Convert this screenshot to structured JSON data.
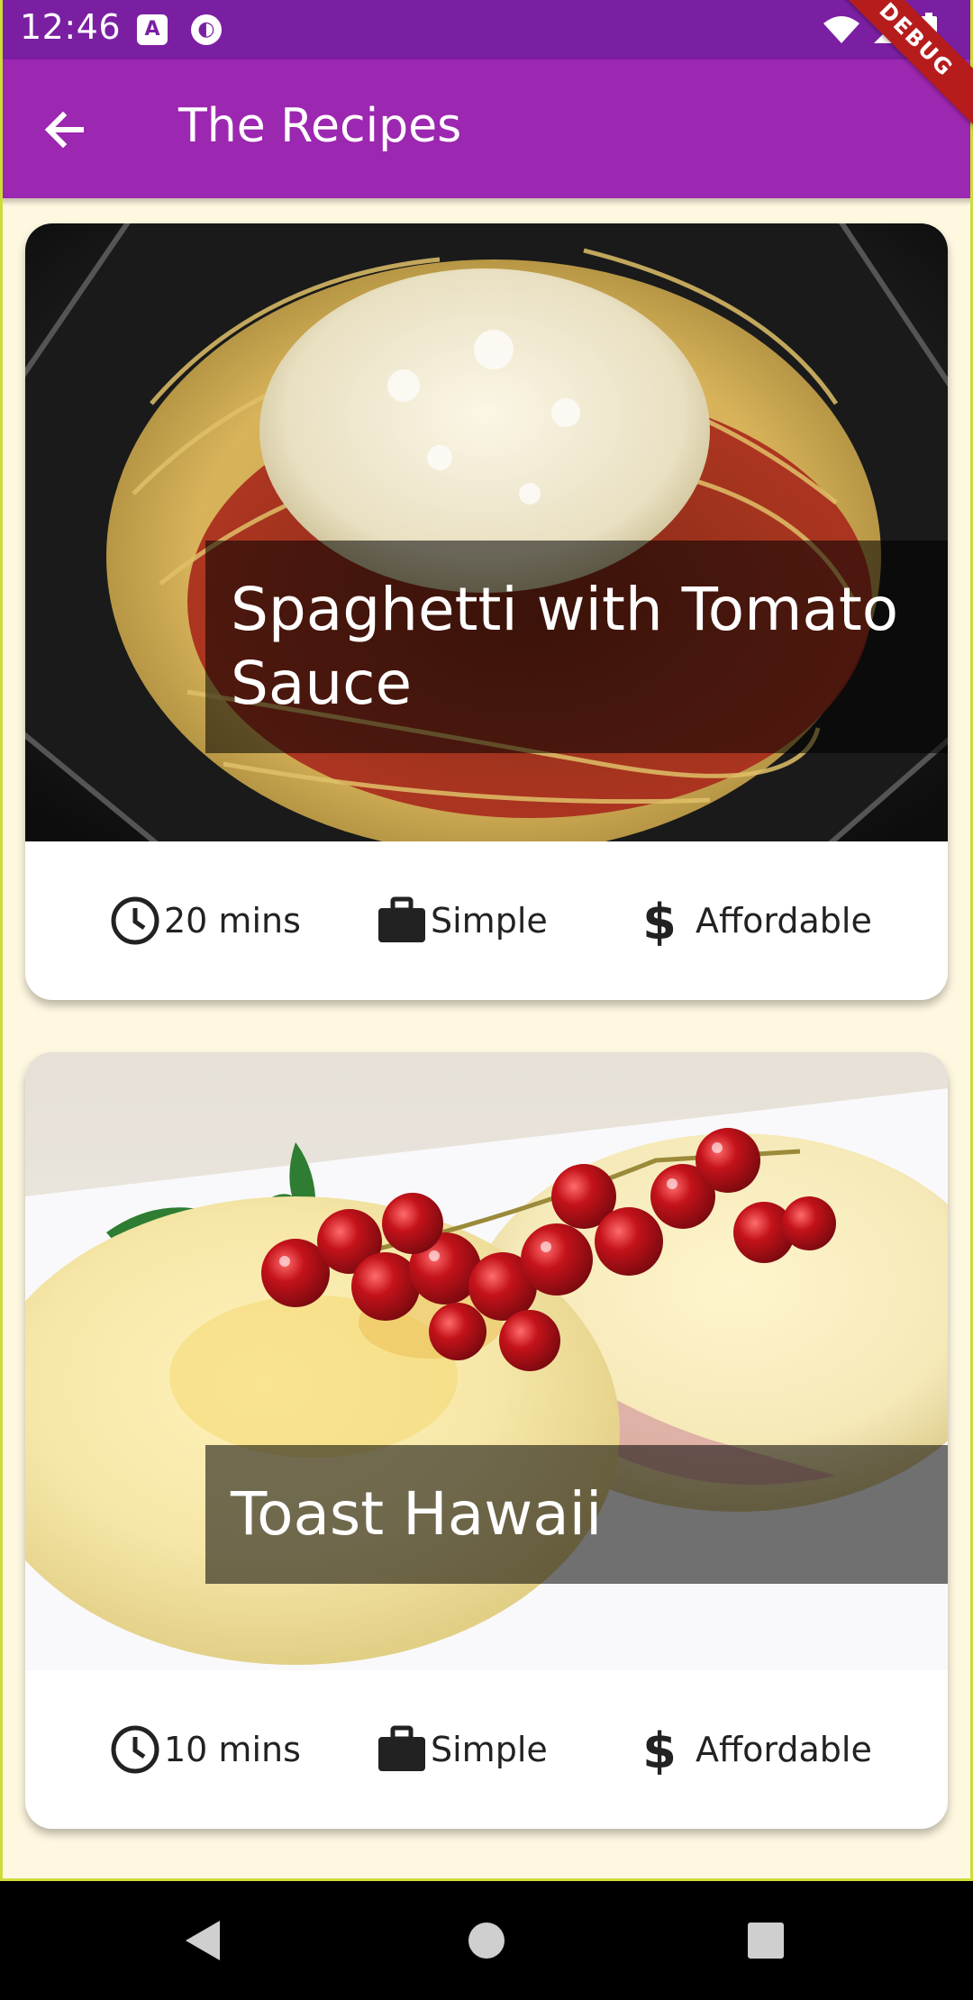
{
  "status_bar": {
    "time": "12:46",
    "icons": [
      "a-notification-icon",
      "circle-notification-icon",
      "wifi-icon",
      "signal-icon",
      "battery-icon"
    ]
  },
  "app_bar": {
    "title": "The Recipes",
    "back_icon": "arrow-back-icon",
    "debug_label": "DEBUG"
  },
  "colors": {
    "status_bar": "#7b1fa2",
    "app_bar": "#9c27b0",
    "background": "#fff8e1",
    "debug_banner": "#b71c1c"
  },
  "recipes": [
    {
      "title": "Spaghetti with Tomato Sauce",
      "duration": "20 mins",
      "complexity": "Simple",
      "affordability": "Affordable",
      "image": "spaghetti-photo"
    },
    {
      "title": "Toast Hawaii",
      "duration": "10 mins",
      "complexity": "Simple",
      "affordability": "Affordable",
      "image": "toast-hawaii-photo"
    }
  ],
  "nav_bar": {
    "icons": [
      "back-triangle-icon",
      "home-circle-icon",
      "recents-square-icon"
    ]
  }
}
